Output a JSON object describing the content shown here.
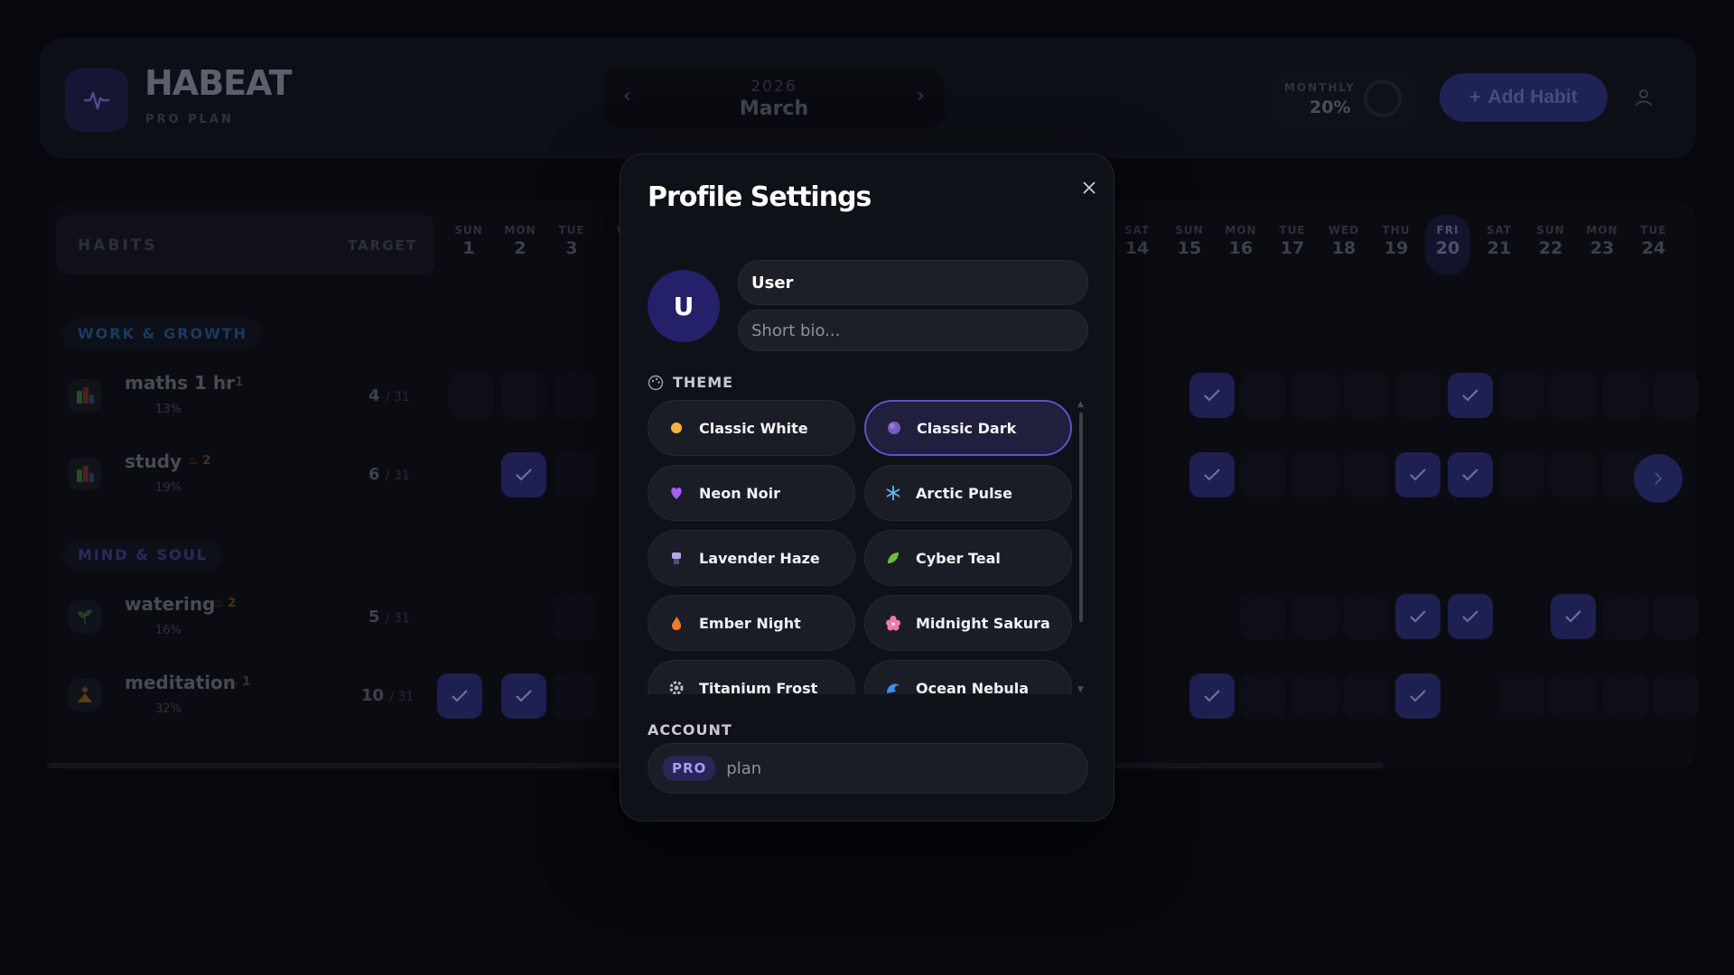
{
  "header": {
    "brand": "HABEAT",
    "plan": "PRO PLAN",
    "year": "2026",
    "month": "March",
    "monthly_label": "MONTHLY",
    "monthly_value": "20%",
    "add_habit": "Add Habit"
  },
  "grid": {
    "habits_label": "HABITS",
    "target_label": "TARGET",
    "days": [
      {
        "dn": "SUN",
        "dd": "1"
      },
      {
        "dn": "MON",
        "dd": "2"
      },
      {
        "dn": "TUE",
        "dd": "3"
      },
      {
        "dn": "W",
        "dd": ""
      },
      {
        "dn": "SAT",
        "dd": "14"
      },
      {
        "dn": "SUN",
        "dd": "15"
      },
      {
        "dn": "MON",
        "dd": "16"
      },
      {
        "dn": "TUE",
        "dd": "17"
      },
      {
        "dn": "WED",
        "dd": "18"
      },
      {
        "dn": "THU",
        "dd": "19"
      },
      {
        "dn": "FRI",
        "dd": "20"
      },
      {
        "dn": "SAT",
        "dd": "21"
      },
      {
        "dn": "SUN",
        "dd": "22"
      },
      {
        "dn": "MON",
        "dd": "23"
      },
      {
        "dn": "TUE",
        "dd": "24"
      }
    ],
    "sections": [
      {
        "title": "WORK & GROWTH",
        "color": "#1b3a5e"
      },
      {
        "title": "MIND & SOUL",
        "color": "#2b2a5e"
      }
    ],
    "habits": [
      {
        "name": "maths 1 hr",
        "streak": "1",
        "pct": "13%",
        "count": "4",
        "total": "/ 31",
        "icon": "chart-icon"
      },
      {
        "name": "study",
        "streak": "2",
        "pct": "19%",
        "count": "6",
        "total": "/ 31",
        "icon": "chart-icon"
      },
      {
        "name": "watering",
        "streak": "2",
        "pct": "16%",
        "count": "5",
        "total": "/ 31",
        "icon": "sprout-icon"
      },
      {
        "name": "meditation",
        "streak": "1",
        "pct": "32%",
        "count": "10",
        "total": "/ 31",
        "icon": "meditation-icon"
      }
    ]
  },
  "modal": {
    "title": "Profile Settings",
    "avatar_letter": "U",
    "name_value": "User",
    "bio_placeholder": "Short bio...",
    "theme_label": "THEME",
    "themes": [
      {
        "label": "Classic White",
        "icon": "sun-icon",
        "selected": false
      },
      {
        "label": "Classic Dark",
        "icon": "moon-icon",
        "selected": true
      },
      {
        "label": "Neon Noir",
        "icon": "heart-icon",
        "selected": false
      },
      {
        "label": "Arctic Pulse",
        "icon": "snowflake-icon",
        "selected": false
      },
      {
        "label": "Lavender Haze",
        "icon": "lavender-icon",
        "selected": false
      },
      {
        "label": "Cyber Teal",
        "icon": "leaf-icon",
        "selected": false
      },
      {
        "label": "Ember Night",
        "icon": "flame-icon",
        "selected": false
      },
      {
        "label": "Midnight Sakura",
        "icon": "blossom-icon",
        "selected": false
      },
      {
        "label": "Titanium Frost",
        "icon": "gear-icon",
        "selected": false
      },
      {
        "label": "Ocean Nebula",
        "icon": "wave-icon",
        "selected": false
      }
    ],
    "account_label": "ACCOUNT",
    "pro_badge": "PRO",
    "plan_text": "plan"
  },
  "colors": {
    "accent": "#5b53c9",
    "background": "#07080d",
    "modal": "#0f1118"
  }
}
